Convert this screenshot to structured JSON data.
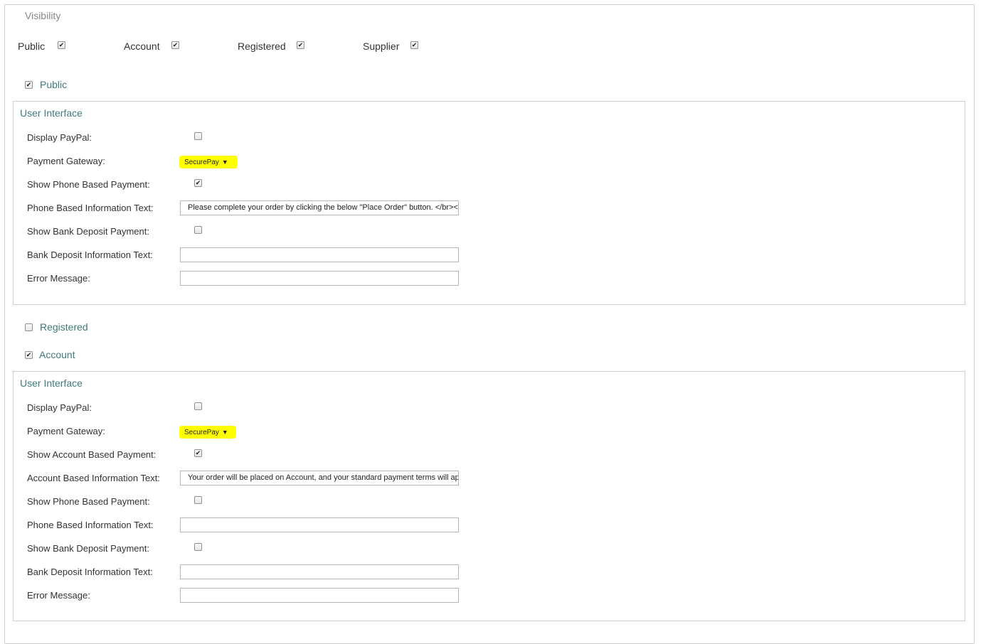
{
  "visibility": {
    "legend": "Visibility",
    "options": [
      {
        "label": "Public",
        "checked": true
      },
      {
        "label": "Account",
        "checked": true
      },
      {
        "label": "Registered",
        "checked": true
      },
      {
        "label": "Supplier",
        "checked": true
      }
    ]
  },
  "groups": {
    "public": {
      "label": "Public",
      "checked": true
    },
    "registered": {
      "label": "Registered",
      "checked": false
    },
    "account": {
      "label": "Account",
      "checked": true
    }
  },
  "public_ui": {
    "title": "User Interface",
    "display_paypal_label": "Display PayPal:",
    "display_paypal_checked": false,
    "payment_gateway_label": "Payment Gateway:",
    "payment_gateway_value": "SecurePay",
    "show_phone_label": "Show Phone Based Payment:",
    "show_phone_checked": true,
    "phone_info_label": "Phone Based Information Text:",
    "phone_info_value": "Please complete your order by clicking the below \"Place Order\" button. </br><",
    "show_bank_label": "Show Bank Deposit Payment:",
    "show_bank_checked": false,
    "bank_info_label": "Bank Deposit Information Text:",
    "bank_info_value": "",
    "error_label": "Error Message:",
    "error_value": ""
  },
  "account_ui": {
    "title": "User Interface",
    "display_paypal_label": "Display PayPal:",
    "display_paypal_checked": false,
    "payment_gateway_label": "Payment Gateway:",
    "payment_gateway_value": "SecurePay",
    "show_account_label": "Show Account Based Payment:",
    "show_account_checked": true,
    "account_info_label": "Account Based Information Text:",
    "account_info_value": "Your order will be placed on Account, and your standard payment terms will ap",
    "show_phone_label": "Show Phone Based Payment:",
    "show_phone_checked": false,
    "phone_info_label": "Phone Based Information Text:",
    "phone_info_value": "",
    "show_bank_label": "Show Bank Deposit Payment:",
    "show_bank_checked": false,
    "bank_info_label": "Bank Deposit Information Text:",
    "bank_info_value": "",
    "error_label": "Error Message:",
    "error_value": ""
  },
  "colors": {
    "accent_text": "#3f7a7a",
    "highlight": "#ffff00",
    "border": "#cfcfcf"
  }
}
